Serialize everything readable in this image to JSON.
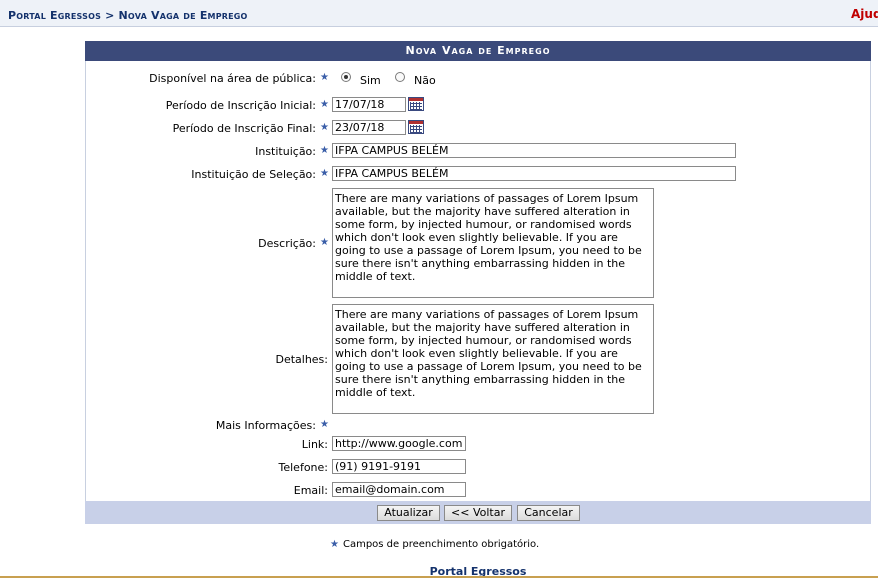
{
  "breadcrumb": "Portal Egressos > Nova Vaga de Emprego",
  "help_link": "Ajuda",
  "panel_title": "Nova Vaga de Emprego",
  "form": {
    "disponivel": {
      "label": "Disponível na área de pública:",
      "options": [
        "Sim",
        "Não"
      ],
      "selected": "Sim"
    },
    "periodo_inicial": {
      "label": "Período de Inscrição Inicial:",
      "value": "17/07/18"
    },
    "periodo_final": {
      "label": "Período de Inscrição Final:",
      "value": "23/07/18"
    },
    "instituicao": {
      "label": "Instituição:",
      "value": "IFPA CAMPUS BELÉM"
    },
    "instituicao_selecao": {
      "label": "Instituição de Seleção:",
      "value": "IFPA CAMPUS BELÉM"
    },
    "descricao": {
      "label": "Descrição:",
      "value": "There are many variations of passages of Lorem Ipsum available, but the majority have suffered alteration in some form, by injected humour, or randomised words which don't look even slightly believable. If you are going to use a passage of Lorem Ipsum, you need to be sure there isn't anything embarrassing hidden in the middle of text."
    },
    "detalhes": {
      "label": "Detalhes:",
      "value": "There are many variations of passages of Lorem Ipsum available, but the majority have suffered alteration in some form, by injected humour, or randomised words which don't look even slightly believable. If you are going to use a passage of Lorem Ipsum, you need to be sure there isn't anything embarrassing hidden in the middle of text."
    },
    "mais_informacoes": {
      "label": "Mais Informações:"
    },
    "link": {
      "label": "Link:",
      "value": "http://www.google.com"
    },
    "telefone": {
      "label": "Telefone:",
      "value": "(91) 9191-9191"
    },
    "email": {
      "label": "Email:",
      "value": "email@domain.com"
    }
  },
  "buttons": {
    "atualizar": "Atualizar",
    "voltar": "<< Voltar",
    "cancelar": "Cancelar"
  },
  "required_note": "Campos de preenchimento obrigatório.",
  "footer_link": "Portal Egressos",
  "colors": {
    "header_bg": "#3b4a7a",
    "breadcrumb": "#14326c",
    "help": "#c00000",
    "footer_bar": "#c8d0e8",
    "required_star": "#3a5ea8"
  },
  "icons": [
    "required-star-icon",
    "calendar-icon"
  ]
}
